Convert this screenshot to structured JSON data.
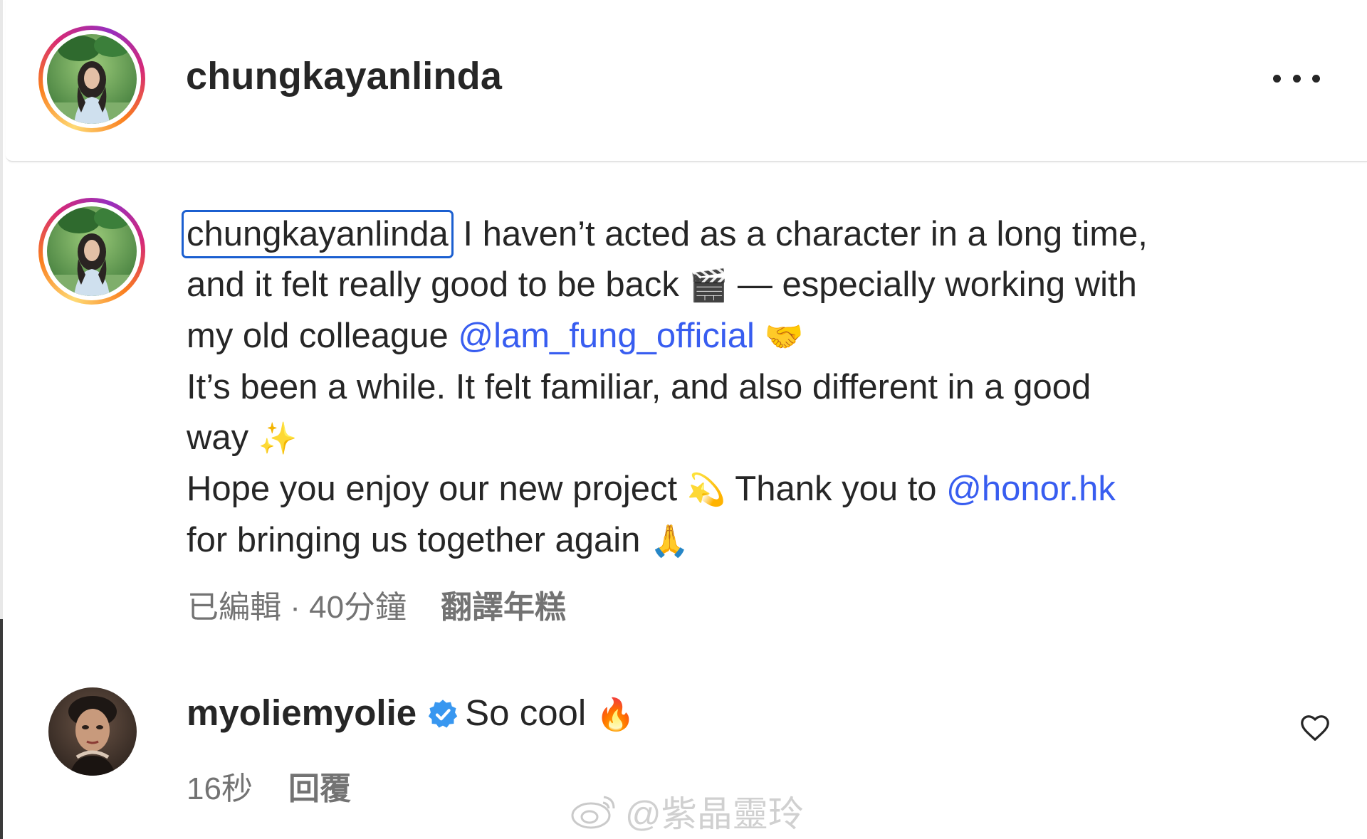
{
  "header": {
    "username": "chungkayanlinda",
    "more_icon": "more-horizontal-icon"
  },
  "caption": {
    "username": "chungkayanlinda",
    "line1_rest": " I haven’t acted as a character in a long time,",
    "line2_text": "and it felt really good to be back ",
    "line2_emoji": "🎬",
    "line2_rest": " — especially working with",
    "line3_text": "my old colleague ",
    "line3_mention": "@lam_fung_official",
    "line3_emoji": "🤝",
    "line4_text": "It’s been a while. It felt familiar, and also different in a good",
    "line5_text": "way ",
    "line5_emoji": "✨",
    "line6_text": "Hope you enjoy our new project ",
    "line6_emoji": "💫",
    "line6_rest": " Thank you to ",
    "line6_mention": "@honor.hk",
    "line7_text": "for bringing us together again ",
    "line7_emoji": "🙏",
    "meta": {
      "edited": "已編輯 · 40分鐘",
      "translate": "翻譯年糕"
    }
  },
  "comment": {
    "username": "myoliemyolie",
    "verified_icon": "verified-badge-icon",
    "text": "So cool ",
    "emoji": "🔥",
    "time": "16秒",
    "reply": "回覆",
    "like_icon": "heart-icon"
  },
  "watermark": {
    "text": "@紫晶靈玲",
    "icon": "weibo-logo-icon"
  },
  "colors": {
    "mention": "#385df0",
    "text": "#262626",
    "meta": "#737373",
    "verified": "#3897f0",
    "focus_outline": "#1b5fd0"
  }
}
